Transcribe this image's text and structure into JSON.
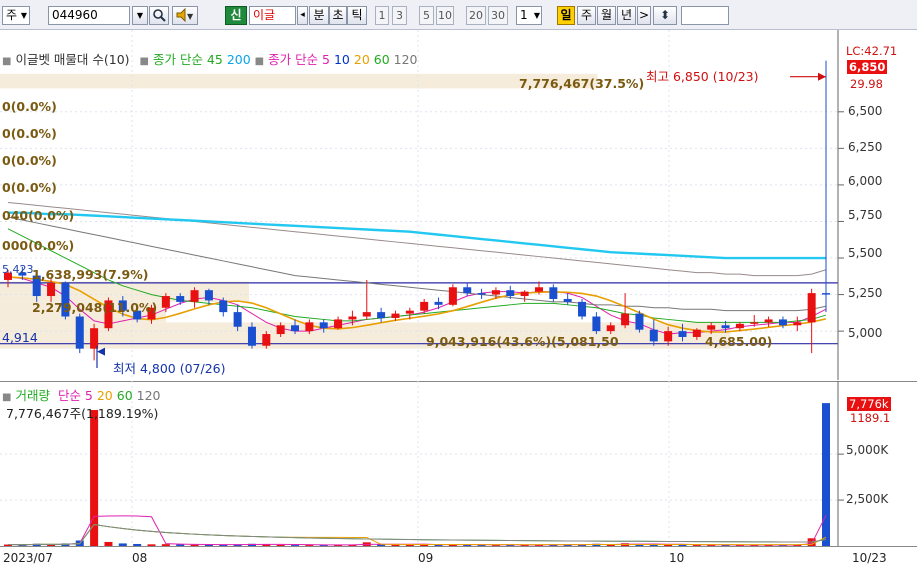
{
  "toolbar": {
    "mode_label": "주",
    "code_value": "044960",
    "new_label": "신",
    "stock_name": "이글",
    "period_items": [
      "분",
      "초",
      "틱"
    ],
    "period_numbers": [
      "1",
      "3",
      "5",
      "10",
      "20",
      "30"
    ],
    "unit_value": "1",
    "day_label": "일",
    "week_label": "주",
    "month_label": "월",
    "year_label": "년",
    "arrow_left": "◂",
    "arrow_right": ">",
    "updown_glyph": "⬍",
    "colors": {
      "selected": "#ffd000",
      "green": "#1f8a3c"
    }
  },
  "price_panel": {
    "legend": {
      "title": "이글벳 매물대 수(10)",
      "ma_label_a": "종가 단순 45",
      "ma_a_value2": "200",
      "ma_label_b": "종가 단순 5",
      "ma_b_values": [
        "10",
        "20",
        "60",
        "120"
      ]
    },
    "volume_profile_labels": [
      "7,776,467(37.5%)",
      "0(0.0%)",
      "0(0.0%)",
      "0(0.0%)",
      "0(0.0%)",
      "040(0.0%)",
      "000(0.0%)",
      "1,638,993(7.9%)",
      "2,279,048(11.0%)",
      "9,043,916(43.6%)(5,081,50",
      "4,685.00)"
    ],
    "left_edge_labels": [
      "5,423",
      "4,914"
    ],
    "high_label": "최고 6,850 (10/23)",
    "low_label": "최저 4,800 (07/26)",
    "right_axis": [
      "6,500",
      "6,250",
      "6,000",
      "5,750",
      "5,500",
      "5,250",
      "5,000"
    ],
    "top_right_tags": [
      "LC:42.71",
      "6,850",
      "29.98"
    ]
  },
  "volume_panel": {
    "legend": {
      "title": "거래량",
      "ma_label": "단순 5",
      "ma_values": [
        "20",
        "60",
        "120"
      ]
    },
    "info_label": "7,776,467주(1,189.19%)",
    "right_axis": [
      "5,000K",
      "2,500K"
    ],
    "top_right_tags": [
      "7,776k",
      "1189.1"
    ]
  },
  "x_axis": {
    "labels": [
      "2023/07",
      "08",
      "09",
      "10"
    ],
    "last_date": "10/23"
  },
  "chart_data": {
    "type": "candlestick",
    "ylim": [
      4700,
      6950
    ],
    "candles": [
      [
        5350,
        5420,
        5300,
        5400
      ],
      [
        5400,
        5440,
        5350,
        5380
      ],
      [
        5380,
        5400,
        5200,
        5240
      ],
      [
        5240,
        5360,
        5200,
        5330
      ],
      [
        5330,
        5340,
        5080,
        5100
      ],
      [
        5100,
        5120,
        4850,
        4880
      ],
      [
        4880,
        5050,
        4800,
        5020
      ],
      [
        5020,
        5230,
        5000,
        5210
      ],
      [
        5210,
        5240,
        5100,
        5140
      ],
      [
        5140,
        5180,
        5060,
        5080
      ],
      [
        5080,
        5180,
        5050,
        5160
      ],
      [
        5160,
        5260,
        5130,
        5240
      ],
      [
        5240,
        5260,
        5180,
        5200
      ],
      [
        5200,
        5300,
        5160,
        5280
      ],
      [
        5280,
        5290,
        5180,
        5210
      ],
      [
        5210,
        5230,
        5100,
        5130
      ],
      [
        5130,
        5180,
        5000,
        5030
      ],
      [
        5030,
        5060,
        4880,
        4900
      ],
      [
        4900,
        5000,
        4880,
        4980
      ],
      [
        4980,
        5060,
        4960,
        5040
      ],
      [
        5040,
        5080,
        4980,
        5000
      ],
      [
        5000,
        5080,
        4980,
        5060
      ],
      [
        5060,
        5080,
        4990,
        5020
      ],
      [
        5020,
        5100,
        5010,
        5080
      ],
      [
        5080,
        5140,
        5040,
        5100
      ],
      [
        5100,
        5350,
        5080,
        5130
      ],
      [
        5130,
        5160,
        5060,
        5090
      ],
      [
        5090,
        5140,
        5070,
        5120
      ],
      [
        5120,
        5160,
        5080,
        5140
      ],
      [
        5140,
        5220,
        5120,
        5200
      ],
      [
        5200,
        5230,
        5150,
        5180
      ],
      [
        5180,
        5320,
        5170,
        5300
      ],
      [
        5300,
        5330,
        5240,
        5260
      ],
      [
        5260,
        5290,
        5220,
        5250
      ],
      [
        5250,
        5300,
        5220,
        5280
      ],
      [
        5280,
        5310,
        5220,
        5240
      ],
      [
        5240,
        5280,
        5200,
        5270
      ],
      [
        5270,
        5340,
        5250,
        5300
      ],
      [
        5300,
        5320,
        5200,
        5220
      ],
      [
        5220,
        5260,
        5180,
        5200
      ],
      [
        5200,
        5220,
        5080,
        5100
      ],
      [
        5100,
        5130,
        4980,
        5000
      ],
      [
        5000,
        5060,
        4980,
        5040
      ],
      [
        5040,
        5260,
        5020,
        5120
      ],
      [
        5120,
        5140,
        4990,
        5010
      ],
      [
        5010,
        5080,
        4900,
        4930
      ],
      [
        4930,
        5030,
        4900,
        5000
      ],
      [
        5000,
        5050,
        4930,
        4960
      ],
      [
        4960,
        5020,
        4940,
        5010
      ],
      [
        5010,
        5060,
        4980,
        5040
      ],
      [
        5040,
        5070,
        4990,
        5020
      ],
      [
        5020,
        5060,
        5000,
        5050
      ],
      [
        5050,
        5110,
        5030,
        5060
      ],
      [
        5060,
        5100,
        5030,
        5080
      ],
      [
        5080,
        5100,
        5020,
        5040
      ],
      [
        5040,
        5100,
        5000,
        5060
      ],
      [
        5060,
        5290,
        4850,
        5260
      ],
      [
        5260,
        6850,
        5130,
        5250
      ]
    ],
    "ma_lines": {
      "ma5": [
        5370,
        5360,
        5330,
        5300,
        5240,
        5150,
        5070,
        5050,
        5070,
        5090,
        5110,
        5150,
        5190,
        5220,
        5230,
        5210,
        5180,
        5120,
        5060,
        5020,
        5000,
        5000,
        5020,
        5040,
        5060,
        5080,
        5090,
        5100,
        5110,
        5130,
        5160,
        5200,
        5240,
        5260,
        5270,
        5270,
        5260,
        5270,
        5270,
        5260,
        5230,
        5170,
        5110,
        5070,
        5050,
        5010,
        4980,
        4990,
        4990,
        5000,
        5010,
        5030,
        5040,
        5050,
        5060,
        5060,
        5100,
        5150
      ],
      "ma20": [
        5700,
        5650,
        5600,
        5550,
        5500,
        5450,
        5400,
        5350,
        5310,
        5280,
        5250,
        5230,
        5210,
        5200,
        5190,
        5180,
        5170,
        5160,
        5140,
        5120,
        5100,
        5090,
        5080,
        5070,
        5070,
        5080,
        5090,
        5100,
        5110,
        5120,
        5130,
        5140,
        5150,
        5160,
        5170,
        5180,
        5190,
        5190,
        5190,
        5180,
        5170,
        5160,
        5140,
        5120,
        5110,
        5090,
        5080,
        5070,
        5060,
        5060,
        5060,
        5060,
        5060,
        5060,
        5060,
        5070,
        5080,
        5110
      ],
      "ma60": [
        5780,
        5760,
        5740,
        5720,
        5700,
        5680,
        5660,
        5640,
        5620,
        5600,
        5580,
        5560,
        5540,
        5520,
        5500,
        5480,
        5460,
        5440,
        5420,
        5400,
        5380,
        5370,
        5360,
        5350,
        5340,
        5330,
        5320,
        5310,
        5300,
        5290,
        5280,
        5270,
        5260,
        5250,
        5240,
        5230,
        5220,
        5210,
        5200,
        5200,
        5190,
        5180,
        5180,
        5170,
        5170,
        5160,
        5160,
        5150,
        5150,
        5150,
        5140,
        5140,
        5140,
        5140,
        5140,
        5140,
        5150,
        5170
      ],
      "ma120": [
        5880,
        5870,
        5860,
        5850,
        5840,
        5830,
        5820,
        5810,
        5800,
        5790,
        5780,
        5770,
        5760,
        5750,
        5740,
        5730,
        5720,
        5710,
        5700,
        5690,
        5680,
        5670,
        5660,
        5650,
        5640,
        5630,
        5620,
        5610,
        5600,
        5590,
        5580,
        5570,
        5560,
        5550,
        5540,
        5530,
        5520,
        5510,
        5500,
        5490,
        5480,
        5470,
        5460,
        5450,
        5440,
        5430,
        5420,
        5410,
        5400,
        5400,
        5390,
        5390,
        5380,
        5380,
        5380,
        5380,
        5390,
        5420
      ],
      "ma200": [
        5810,
        5810,
        5805,
        5800,
        5800,
        5795,
        5790,
        5785,
        5780,
        5775,
        5770,
        5765,
        5760,
        5755,
        5750,
        5745,
        5740,
        5735,
        5730,
        5725,
        5720,
        5715,
        5710,
        5705,
        5700,
        5695,
        5690,
        5685,
        5680,
        5670,
        5660,
        5650,
        5640,
        5630,
        5620,
        5610,
        5600,
        5590,
        5580,
        5570,
        5560,
        5550,
        5540,
        5535,
        5530,
        5525,
        5520,
        5515,
        5510,
        5505,
        5500,
        5500,
        5500,
        5500,
        5500,
        5500,
        5500,
        5500
      ]
    },
    "volumes": [
      80,
      60,
      120,
      90,
      140,
      300,
      7400,
      220,
      140,
      110,
      90,
      100,
      80,
      70,
      60,
      80,
      90,
      120,
      80,
      60,
      50,
      50,
      60,
      70,
      60,
      200,
      90,
      70,
      60,
      80,
      60,
      90,
      70,
      60,
      50,
      70,
      60,
      80,
      90,
      70,
      80,
      120,
      60,
      150,
      90,
      110,
      70,
      60,
      50,
      60,
      50,
      50,
      60,
      50,
      40,
      60,
      420,
      7776
    ],
    "volume_ylim": [
      0,
      8000
    ],
    "price_levels": [
      5330,
      4914
    ]
  }
}
